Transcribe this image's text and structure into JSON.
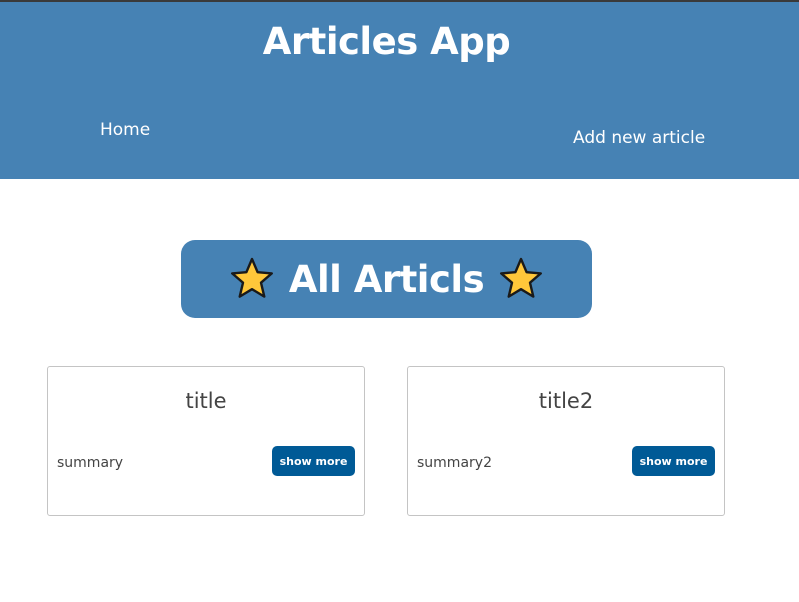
{
  "header": {
    "title": "Articles App",
    "nav": {
      "home_label": "Home",
      "add_label": "Add new article"
    }
  },
  "banner": {
    "text": "All Articls",
    "icon": "star-icon"
  },
  "articles": [
    {
      "title": "title",
      "summary": "summary",
      "button_label": "show more"
    },
    {
      "title": "title2",
      "summary": "summary2",
      "button_label": "show more"
    }
  ],
  "colors": {
    "header_bg": "#4682b4",
    "button_bg": "#005a96",
    "star_fill": "#ffc73a"
  }
}
